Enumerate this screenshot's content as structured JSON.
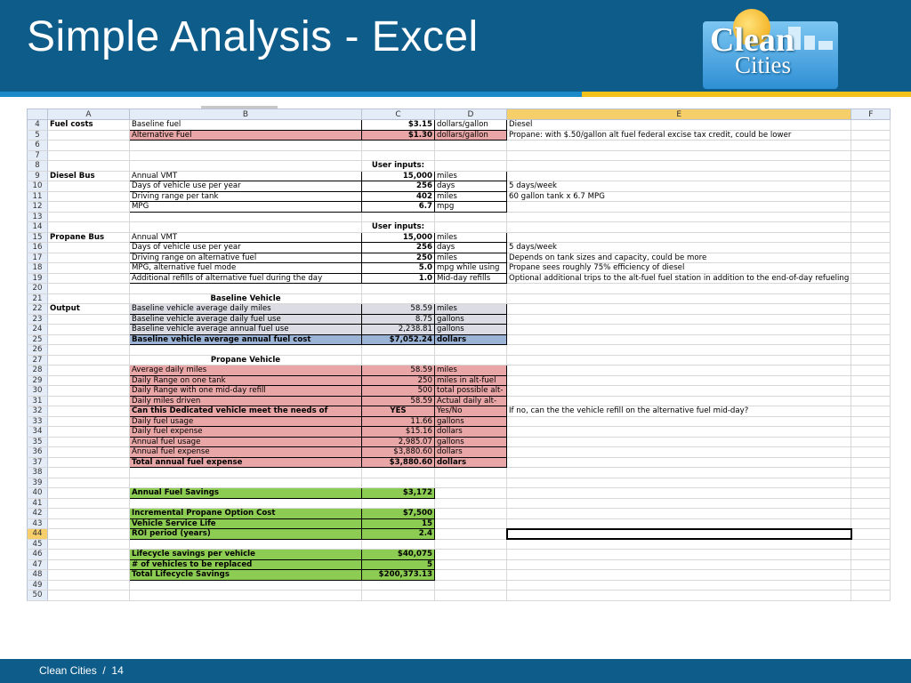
{
  "slide": {
    "title": "Simple Analysis - Excel",
    "footer_org": "Clean Cities",
    "footer_sep": "/",
    "footer_page": "14",
    "logo": {
      "line1": "Clean",
      "line2": "Cities"
    }
  },
  "colors": {
    "header": "#0e5c8a",
    "stripe_blue": "#1b8ac9",
    "stripe_gold": "#f2c21a",
    "pink": "#e9a6a6",
    "gray": "#dcdce4",
    "blue": "#9bb4d6",
    "green": "#8ccc52",
    "selected_header": "#f6cf6a"
  },
  "sheet": {
    "columns": [
      "A",
      "B",
      "C",
      "D",
      "E",
      "F"
    ],
    "selected_row": "44",
    "selected_column": "E",
    "rows": [
      {
        "n": "4",
        "a": "Fuel costs",
        "b": "Baseline fuel",
        "c": "$3.15",
        "d": "dollars/gallon",
        "e": "Diesel"
      },
      {
        "n": "5",
        "a": "",
        "b": "Alternative Fuel",
        "c": "$1.30",
        "d": "dollars/gallon",
        "e": "Propane: with $.50/gallon alt fuel federal excise tax credit, could be lower"
      },
      {
        "n": "6"
      },
      {
        "n": "7"
      },
      {
        "n": "8",
        "c": "User inputs:"
      },
      {
        "n": "9",
        "a": "Diesel Bus",
        "b": "Annual VMT",
        "c": "15,000",
        "d": "miles"
      },
      {
        "n": "10",
        "b": "Days of vehicle use per year",
        "c": "256",
        "d": "days",
        "e": "5 days/week"
      },
      {
        "n": "11",
        "b": "Driving range per tank",
        "c": "402",
        "d": "miles",
        "e": "60 gallon tank x 6.7 MPG"
      },
      {
        "n": "12",
        "b": "MPG",
        "c": "6.7",
        "d": "mpg"
      },
      {
        "n": "13"
      },
      {
        "n": "14",
        "c": "User inputs:"
      },
      {
        "n": "15",
        "a": "Propane Bus",
        "b": "Annual VMT",
        "c": "15,000",
        "d": "miles"
      },
      {
        "n": "16",
        "b": "Days of vehicle use per year",
        "c": "256",
        "d": "days",
        "e": "5 days/week"
      },
      {
        "n": "17",
        "b": "Driving range on alternative fuel",
        "c": "250",
        "d": "miles",
        "e": "Depends on tank sizes and capacity, could be more"
      },
      {
        "n": "18",
        "b": "MPG, alternative fuel mode",
        "c": "5.0",
        "d": "mpg while using",
        "e": "Propane sees roughly 75% efficiency of diesel"
      },
      {
        "n": "19",
        "b": "Additional refills of alternative fuel during the day",
        "c": "1.0",
        "d": "Mid-day refills",
        "e": "Optional additional trips to the alt-fuel fuel station in addition to the end-of-day refueling"
      },
      {
        "n": "20"
      },
      {
        "n": "21",
        "b": "Baseline Vehicle"
      },
      {
        "n": "22",
        "a": "Output",
        "b": "Baseline vehicle average daily miles",
        "c": "58.59",
        "d": "miles"
      },
      {
        "n": "23",
        "b": "Baseline vehicle average daily fuel use",
        "c": "8.75",
        "d": "gallons"
      },
      {
        "n": "24",
        "b": "Baseline vehicle average annual fuel use",
        "c": "2,238.81",
        "d": "gallons"
      },
      {
        "n": "25",
        "b": "Baseline vehicle average annual fuel cost",
        "c": "$7,052.24",
        "d": "dollars"
      },
      {
        "n": "26"
      },
      {
        "n": "27",
        "b": "Propane Vehicle"
      },
      {
        "n": "28",
        "b": "Average daily miles",
        "c": "58.59",
        "d": "miles"
      },
      {
        "n": "29",
        "b": "Daily Range on one tank",
        "c": "250",
        "d": "miles in alt-fuel"
      },
      {
        "n": "30",
        "b": "Daily Range with one mid-day refill",
        "c": "500",
        "d": "total possible alt-"
      },
      {
        "n": "31",
        "b": "Daily miles driven",
        "c": "58.59",
        "d": "Actual daily alt-"
      },
      {
        "n": "32",
        "b": "Can this Dedicated vehicle meet the needs of",
        "c": "YES",
        "d": "Yes/No",
        "e": "If no, can the the vehicle refill on the alternative fuel mid-day?"
      },
      {
        "n": "33",
        "b": "Daily fuel usage",
        "c": "11.66",
        "d": "gallons"
      },
      {
        "n": "34",
        "b": "Daily fuel expense",
        "c": "$15.16",
        "d": "dollars"
      },
      {
        "n": "35",
        "b": "Annual fuel usage",
        "c": "2,985.07",
        "d": "gallons"
      },
      {
        "n": "36",
        "b": "Annual fuel expense",
        "c": "$3,880.60",
        "d": "dollars"
      },
      {
        "n": "37",
        "b": "Total annual fuel expense",
        "c": "$3,880.60",
        "d": "dollars"
      },
      {
        "n": "38"
      },
      {
        "n": "39"
      },
      {
        "n": "40",
        "b": "Annual Fuel Savings",
        "c": "$3,172"
      },
      {
        "n": "41"
      },
      {
        "n": "42",
        "b": "Incremental Propane Option Cost",
        "c": "$7,500"
      },
      {
        "n": "43",
        "b": "Vehicle Service Life",
        "c": "15"
      },
      {
        "n": "44",
        "b": "ROI period (years)",
        "c": "2.4"
      },
      {
        "n": "45"
      },
      {
        "n": "46",
        "b": "Lifecycle savings per vehicle",
        "c": "$40,075"
      },
      {
        "n": "47",
        "b": "# of vehicles to be replaced",
        "c": "5"
      },
      {
        "n": "48",
        "b": "Total Lifecycle Savings",
        "c": "$200,373.13"
      },
      {
        "n": "49"
      },
      {
        "n": "50"
      }
    ]
  }
}
